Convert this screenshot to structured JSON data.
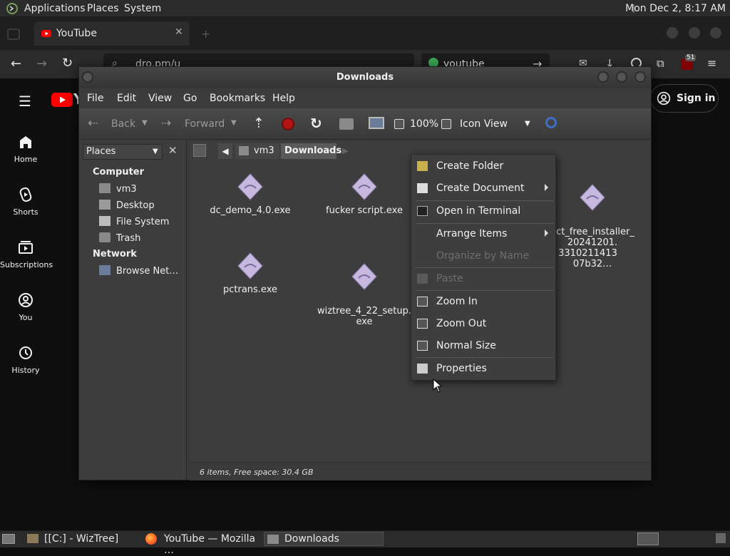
{
  "top_panel": {
    "applications_label": "Applications",
    "places_label": "Places",
    "system_label": "System",
    "clock": "Mon Dec 2, 8:17 AM"
  },
  "browser": {
    "tab_title": "YouTube",
    "url_text": "dro.pm/u",
    "search_text": "youtube",
    "ublock_badge": "51"
  },
  "youtube": {
    "sidebar": [
      {
        "label": "Home",
        "icon": "home-icon"
      },
      {
        "label": "Shorts",
        "icon": "shorts-icon"
      },
      {
        "label": "Subscriptions",
        "icon": "subscriptions-icon"
      },
      {
        "label": "You",
        "icon": "you-icon"
      },
      {
        "label": "History",
        "icon": "history-icon"
      }
    ],
    "logo_letter": "Y",
    "signin_label": "Sign in"
  },
  "file_manager": {
    "title": "Downloads",
    "menu": [
      "File",
      "Edit",
      "View",
      "Go",
      "Bookmarks",
      "Help"
    ],
    "toolbar": {
      "back_label": "Back",
      "forward_label": "Forward",
      "zoom_level": "100%",
      "view_mode": "Icon View"
    },
    "side_pane": {
      "combo_label": "Places",
      "computer_header": "Computer",
      "computer_items": [
        "vm3",
        "Desktop",
        "File System",
        "Trash"
      ],
      "network_header": "Network",
      "network_items": [
        "Browse Net…"
      ]
    },
    "path": [
      "vm3",
      "Downloads"
    ],
    "files": [
      {
        "name": "dc_demo_4.0.exe"
      },
      {
        "name": "fucker script.exe"
      },
      {
        "name": "oct_free_installer_\n20241201.\n3310211413 07b32…"
      },
      {
        "name": "pctrans.exe"
      },
      {
        "name": "wiztree_4_22_setup.\nexe"
      }
    ],
    "status": "6 items, Free space: 30.4 GB"
  },
  "context_menu": {
    "items": [
      {
        "label": "Create Folder",
        "enabled": true
      },
      {
        "label": "Create Document",
        "enabled": true,
        "submenu": true
      },
      {
        "label": "Open in Terminal",
        "enabled": true
      },
      {
        "label": "Arrange Items",
        "enabled": true,
        "submenu": true
      },
      {
        "label": "Organize by Name",
        "enabled": false
      },
      {
        "label": "Paste",
        "enabled": false
      },
      {
        "label": "Zoom In",
        "enabled": true
      },
      {
        "label": "Zoom Out",
        "enabled": true
      },
      {
        "label": "Normal Size",
        "enabled": true
      },
      {
        "label": "Properties",
        "enabled": true
      }
    ]
  },
  "taskbar": {
    "tasks": [
      {
        "label": "[[C:] - WizTree]",
        "active": false
      },
      {
        "label": "YouTube — Mozilla …",
        "active": false
      },
      {
        "label": "Downloads",
        "active": true
      }
    ]
  },
  "colors": {
    "youtube_red": "#ff0000",
    "panel_bg": "#2b2b2b",
    "window_bg": "#3d3d3d",
    "file_icon": "#c7b8e0"
  }
}
